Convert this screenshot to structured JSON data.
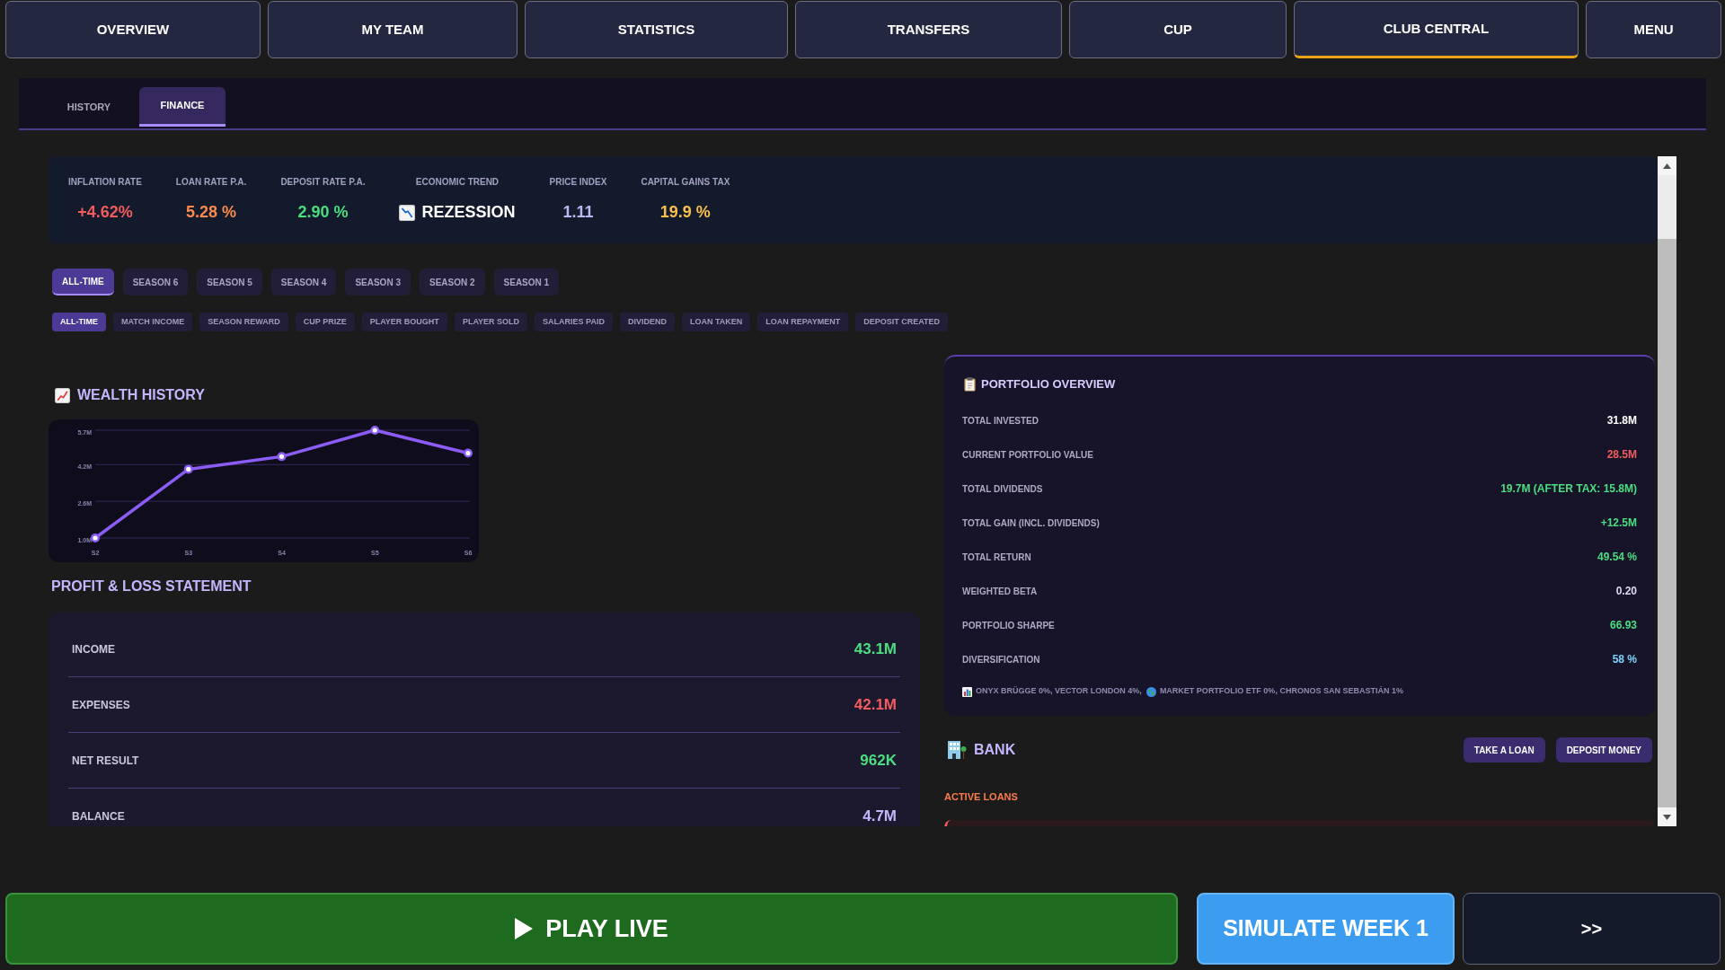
{
  "nav": [
    {
      "label": "OVERVIEW",
      "selected": false
    },
    {
      "label": "MY TEAM",
      "selected": false
    },
    {
      "label": "STATISTICS",
      "selected": false
    },
    {
      "label": "TRANSFERS",
      "selected": false
    },
    {
      "label": "CUP",
      "selected": false
    },
    {
      "label": "CLUB CENTRAL",
      "selected": true
    },
    {
      "label": "MENU",
      "selected": false
    }
  ],
  "subtabs": [
    {
      "label": "HISTORY",
      "selected": false
    },
    {
      "label": "FINANCE",
      "selected": true
    }
  ],
  "economy": [
    {
      "kind": "rate",
      "label": "INFLATION RATE",
      "value": "+4.62%",
      "color": "#f25c5c"
    },
    {
      "kind": "rate",
      "label": "LOAN RATE P.A.",
      "value": "5.28 %",
      "color": "#fb8a4c"
    },
    {
      "kind": "rate",
      "label": "DEPOSIT RATE P.A.",
      "value": "2.90 %",
      "color": "#4ade80"
    },
    {
      "kind": "trend",
      "label": "ECONOMIC TREND",
      "value": "REZESSION",
      "color": "#ffffff"
    },
    {
      "kind": "rate",
      "label": "PRICE INDEX",
      "value": "1.11",
      "color": "#b9b9f2"
    },
    {
      "kind": "rate",
      "label": "CAPITAL GAINS TAX",
      "value": "19.9 %",
      "color": "#fbbf4d"
    }
  ],
  "season_filters": [
    {
      "label": "ALL-TIME",
      "selected": true
    },
    {
      "label": "SEASON 6",
      "selected": false
    },
    {
      "label": "SEASON 5",
      "selected": false
    },
    {
      "label": "SEASON 4",
      "selected": false
    },
    {
      "label": "SEASON 3",
      "selected": false
    },
    {
      "label": "SEASON 2",
      "selected": false
    },
    {
      "label": "SEASON 1",
      "selected": false
    }
  ],
  "category_filters": [
    {
      "label": "ALL-TIME",
      "selected": true
    },
    {
      "label": "MATCH INCOME",
      "selected": false
    },
    {
      "label": "SEASON REWARD",
      "selected": false
    },
    {
      "label": "CUP PRIZE",
      "selected": false
    },
    {
      "label": "PLAYER BOUGHT",
      "selected": false
    },
    {
      "label": "PLAYER SOLD",
      "selected": false
    },
    {
      "label": "SALARIES PAID",
      "selected": false
    },
    {
      "label": "DIVIDEND",
      "selected": false
    },
    {
      "label": "LOAN TAKEN",
      "selected": false
    },
    {
      "label": "LOAN REPAYMENT",
      "selected": false
    },
    {
      "label": "DEPOSIT CREATED",
      "selected": false
    }
  ],
  "wealth_history": {
    "title": "WEALTH HISTORY",
    "chart_data": {
      "type": "line",
      "categories": [
        "S2",
        "S3",
        "S4",
        "S5",
        "S6"
      ],
      "series": [
        {
          "color": "#8b5cf6",
          "marker": "circle",
          "values": [
            1.0,
            4.0,
            4.55,
            5.7,
            4.7
          ]
        }
      ],
      "ylim": [
        1.0,
        5.7
      ],
      "yticks": [
        {
          "value": 1.0,
          "label": "1.0M"
        },
        {
          "value": 2.6,
          "label": "2.6M"
        },
        {
          "value": 4.2,
          "label": "4.2M"
        },
        {
          "value": 5.7,
          "label": "5.7M"
        }
      ]
    }
  },
  "profit_loss": {
    "title": "PROFIT & LOSS STATEMENT",
    "rows": [
      {
        "label": "INCOME",
        "value": "43.1M",
        "color": "#4ade80"
      },
      {
        "label": "EXPENSES",
        "value": "42.1M",
        "color": "#f25c5c"
      },
      {
        "label": "NET RESULT",
        "value": "962K",
        "color": "#4ade80"
      },
      {
        "label": "BALANCE",
        "value": "4.7M",
        "color": "#c4b5fd"
      }
    ]
  },
  "portfolio": {
    "title": "PORTFOLIO OVERVIEW",
    "rows": [
      {
        "label": "TOTAL INVESTED",
        "value": "31.8M",
        "color": "#ffffff"
      },
      {
        "label": "CURRENT PORTFOLIO VALUE",
        "value": "28.5M",
        "color": "#f25c5c"
      },
      {
        "label": "TOTAL DIVIDENDS",
        "value": "19.7M (AFTER TAX: 15.8M)",
        "color": "#4ade80"
      },
      {
        "label": "TOTAL GAIN (INCL. DIVIDENDS)",
        "value": "+12.5M",
        "color": "#4ade80"
      },
      {
        "label": "TOTAL RETURN",
        "value": "49.54 %",
        "color": "#4ade80"
      },
      {
        "label": "WEIGHTED BETA",
        "value": "0.20",
        "color": "#dcd8f5"
      },
      {
        "label": "PORTFOLIO SHARPE",
        "value": "66.93",
        "color": "#4ade80"
      },
      {
        "label": "DIVERSIFICATION",
        "value": "58 %",
        "color": "#7dd3fc"
      }
    ],
    "holdings": [
      "ONYX BRÜGGE 0%, VECTOR LONDON 4%,",
      "MARKET PORTFOLIO ETF 0%, CHRONOS SAN SEBASTIÁN 1%"
    ]
  },
  "bank": {
    "title": "BANK",
    "buttons": [
      "TAKE A LOAN",
      "DEPOSIT MONEY"
    ],
    "active_loans": {
      "title": "ACTIVE LOANS"
    }
  },
  "actions": [
    {
      "kind": "play",
      "label": "PLAY LIVE"
    },
    {
      "kind": "simulate",
      "label": "SIMULATE WEEK 1"
    },
    {
      "kind": "next",
      "label": ">>"
    }
  ]
}
